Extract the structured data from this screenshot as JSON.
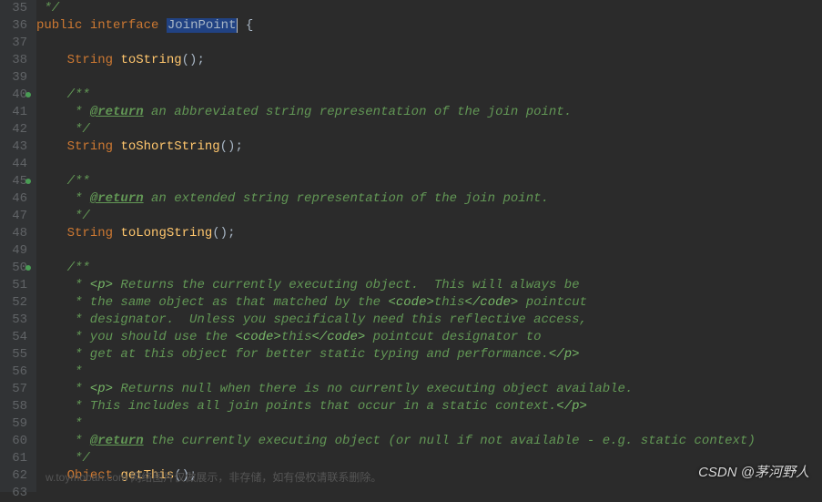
{
  "lines": {
    "start": 35,
    "end": 63,
    "markers": [
      40,
      45,
      50
    ]
  },
  "code": {
    "l35": " */",
    "l36_kw1": "public",
    "l36_kw2": "interface",
    "l36_cls": "JoinPoint",
    "l36_end": " {",
    "l37": "",
    "l38_type": "String",
    "l38_method": "toString",
    "l38_end": "();",
    "l39": "",
    "l40": "    /**",
    "l41_pre": "     * ",
    "l41_tag": "@return",
    "l41_txt": " an abbreviated string representation of the join point.",
    "l42": "     */",
    "l43_type": "String",
    "l43_method": "toShortString",
    "l43_end": "();",
    "l44": "",
    "l45": "    /**",
    "l46_pre": "     * ",
    "l46_tag": "@return",
    "l46_txt": " an extended string representation of the join point.",
    "l47": "     */",
    "l48_type": "String",
    "l48_method": "toLongString",
    "l48_end": "();",
    "l49": "",
    "l50": "    /**",
    "l51_pre": "     * ",
    "l51_tag1": "<p>",
    "l51_txt": " Returns the currently executing object.  This will always be",
    "l52_pre": "     * the same object as that matched by the ",
    "l52_tag1": "<code>",
    "l52_mid": "this",
    "l52_tag2": "</code>",
    "l52_txt": " pointcut",
    "l53": "     * designator.  Unless you specifically need this reflective access,",
    "l54_pre": "     * you should use the ",
    "l54_tag1": "<code>",
    "l54_mid": "this",
    "l54_tag2": "</code>",
    "l54_txt": " pointcut designator to",
    "l55_pre": "     * get at this object for better static typing and performance.",
    "l55_tag": "</p>",
    "l56": "     *",
    "l57_pre": "     * ",
    "l57_tag": "<p>",
    "l57_txt": " Returns null when there is no currently executing object available.",
    "l58_pre": "     * This includes all join points that occur in a static context.",
    "l58_tag": "</p>",
    "l59": "     *",
    "l60_pre": "     * ",
    "l60_tag": "@return",
    "l60_txt": " the currently executing object (or null if not available - e.g. static context)",
    "l61": "     */",
    "l62_type": "Object",
    "l62_method": "getThis",
    "l62_end": "();",
    "l63": ""
  },
  "watermark": {
    "bottom": "w.toymoban.com 网络图片仅做展示，非存储，如有侵权请联系删除。",
    "right": "CSDN @茅河野人"
  }
}
